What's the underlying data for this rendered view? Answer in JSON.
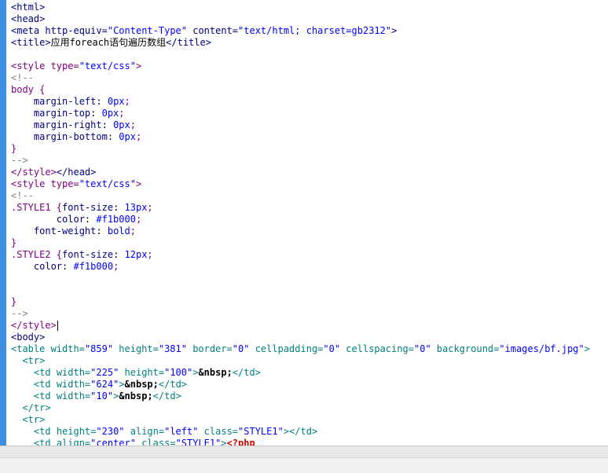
{
  "editor": {
    "lines": [
      [
        {
          "c": "tag",
          "t": "<html>"
        }
      ],
      [
        {
          "c": "tag",
          "t": "<head>"
        }
      ],
      [
        {
          "c": "tag",
          "t": "<meta "
        },
        {
          "c": "tag",
          "t": "http-equiv="
        },
        {
          "c": "val",
          "t": "\"Content-Type\""
        },
        {
          "c": "tag",
          "t": " content="
        },
        {
          "c": "val",
          "t": "\"text/html; charset=gb2312\""
        },
        {
          "c": "tag",
          "t": ">"
        }
      ],
      [
        {
          "c": "tag",
          "t": "<title>"
        },
        {
          "c": "text",
          "t": "应用foreach语句遍历数组"
        },
        {
          "c": "tag",
          "t": "</title>"
        }
      ],
      [],
      [
        {
          "c": "style",
          "t": "<style "
        },
        {
          "c": "style",
          "t": "type="
        },
        {
          "c": "val",
          "t": "\"text/css\""
        },
        {
          "c": "style",
          "t": ">"
        }
      ],
      [
        {
          "c": "comment",
          "t": "<!--"
        }
      ],
      [
        {
          "c": "css",
          "t": "body {"
        }
      ],
      [
        {
          "c": "text",
          "t": "    "
        },
        {
          "c": "prop",
          "t": "margin-left"
        },
        {
          "c": "text",
          "t": ": "
        },
        {
          "c": "propval",
          "t": "0px"
        },
        {
          "c": "css",
          "t": ";"
        }
      ],
      [
        {
          "c": "text",
          "t": "    "
        },
        {
          "c": "prop",
          "t": "margin-top"
        },
        {
          "c": "text",
          "t": ": "
        },
        {
          "c": "propval",
          "t": "0px"
        },
        {
          "c": "css",
          "t": ";"
        }
      ],
      [
        {
          "c": "text",
          "t": "    "
        },
        {
          "c": "prop",
          "t": "margin-right"
        },
        {
          "c": "text",
          "t": ": "
        },
        {
          "c": "propval",
          "t": "0px"
        },
        {
          "c": "css",
          "t": ";"
        }
      ],
      [
        {
          "c": "text",
          "t": "    "
        },
        {
          "c": "prop",
          "t": "margin-bottom"
        },
        {
          "c": "text",
          "t": ": "
        },
        {
          "c": "propval",
          "t": "0px"
        },
        {
          "c": "css",
          "t": ";"
        }
      ],
      [
        {
          "c": "css",
          "t": "}"
        }
      ],
      [
        {
          "c": "comment",
          "t": "-->"
        }
      ],
      [
        {
          "c": "style",
          "t": "</style>"
        },
        {
          "c": "tag",
          "t": "</head>"
        }
      ],
      [
        {
          "c": "style",
          "t": "<style "
        },
        {
          "c": "style",
          "t": "type="
        },
        {
          "c": "val",
          "t": "\"text/css\""
        },
        {
          "c": "style",
          "t": ">"
        }
      ],
      [
        {
          "c": "comment",
          "t": "<!--"
        }
      ],
      [
        {
          "c": "css",
          "t": ".STYLE1 {"
        },
        {
          "c": "prop",
          "t": "font-size"
        },
        {
          "c": "text",
          "t": ": "
        },
        {
          "c": "propval",
          "t": "13px"
        },
        {
          "c": "css",
          "t": ";"
        }
      ],
      [
        {
          "c": "text",
          "t": "        "
        },
        {
          "c": "prop",
          "t": "color"
        },
        {
          "c": "text",
          "t": ": "
        },
        {
          "c": "propval",
          "t": "#f1b000"
        },
        {
          "c": "css",
          "t": ";"
        }
      ],
      [
        {
          "c": "text",
          "t": "    "
        },
        {
          "c": "prop",
          "t": "font-weight"
        },
        {
          "c": "text",
          "t": ": "
        },
        {
          "c": "propval",
          "t": "bold"
        },
        {
          "c": "css",
          "t": ";"
        }
      ],
      [
        {
          "c": "css",
          "t": "}"
        }
      ],
      [
        {
          "c": "css",
          "t": ".STYLE2 {"
        },
        {
          "c": "prop",
          "t": "font-size"
        },
        {
          "c": "text",
          "t": ": "
        },
        {
          "c": "propval",
          "t": "12px"
        },
        {
          "c": "css",
          "t": ";"
        }
      ],
      [
        {
          "c": "text",
          "t": "    "
        },
        {
          "c": "prop",
          "t": "color"
        },
        {
          "c": "text",
          "t": ": "
        },
        {
          "c": "propval",
          "t": "#f1b000"
        },
        {
          "c": "css",
          "t": ";"
        }
      ],
      [],
      [],
      [
        {
          "c": "css",
          "t": "}"
        }
      ],
      [
        {
          "c": "comment",
          "t": "-->"
        }
      ],
      [
        {
          "c": "style",
          "t": "</style>"
        },
        {
          "c": "caret",
          "t": ""
        }
      ],
      [
        {
          "c": "tag",
          "t": "<body>"
        }
      ],
      [
        {
          "c": "attr",
          "t": "<table "
        },
        {
          "c": "attr",
          "t": "width="
        },
        {
          "c": "val",
          "t": "\"859\""
        },
        {
          "c": "attr",
          "t": " height="
        },
        {
          "c": "val",
          "t": "\"381\""
        },
        {
          "c": "attr",
          "t": " border="
        },
        {
          "c": "val",
          "t": "\"0\""
        },
        {
          "c": "attr",
          "t": " cellpadding="
        },
        {
          "c": "val",
          "t": "\"0\""
        },
        {
          "c": "attr",
          "t": " cellspacing="
        },
        {
          "c": "val",
          "t": "\"0\""
        },
        {
          "c": "attr",
          "t": " background="
        },
        {
          "c": "val",
          "t": "\"images/bf.jpg\""
        },
        {
          "c": "attr",
          "t": ">"
        }
      ],
      [
        {
          "c": "text",
          "t": "  "
        },
        {
          "c": "attr",
          "t": "<tr>"
        }
      ],
      [
        {
          "c": "text",
          "t": "    "
        },
        {
          "c": "attr",
          "t": "<td "
        },
        {
          "c": "attr",
          "t": "width="
        },
        {
          "c": "val",
          "t": "\"225\""
        },
        {
          "c": "attr",
          "t": " height="
        },
        {
          "c": "val",
          "t": "\"100\""
        },
        {
          "c": "attr",
          "t": ">"
        },
        {
          "c": "entity",
          "t": "&nbsp;"
        },
        {
          "c": "attr",
          "t": "</td>"
        }
      ],
      [
        {
          "c": "text",
          "t": "    "
        },
        {
          "c": "attr",
          "t": "<td "
        },
        {
          "c": "attr",
          "t": "width="
        },
        {
          "c": "val",
          "t": "\"624\""
        },
        {
          "c": "attr",
          "t": ">"
        },
        {
          "c": "entity",
          "t": "&nbsp;"
        },
        {
          "c": "attr",
          "t": "</td>"
        }
      ],
      [
        {
          "c": "text",
          "t": "    "
        },
        {
          "c": "attr",
          "t": "<td "
        },
        {
          "c": "attr",
          "t": "width="
        },
        {
          "c": "val",
          "t": "\"10\""
        },
        {
          "c": "attr",
          "t": ">"
        },
        {
          "c": "entity",
          "t": "&nbsp;"
        },
        {
          "c": "attr",
          "t": "</td>"
        }
      ],
      [
        {
          "c": "text",
          "t": "  "
        },
        {
          "c": "attr",
          "t": "</tr>"
        }
      ],
      [
        {
          "c": "text",
          "t": "  "
        },
        {
          "c": "attr",
          "t": "<tr>"
        }
      ],
      [
        {
          "c": "text",
          "t": "    "
        },
        {
          "c": "attr",
          "t": "<td "
        },
        {
          "c": "attr",
          "t": "height="
        },
        {
          "c": "val",
          "t": "\"230\""
        },
        {
          "c": "attr",
          "t": " align="
        },
        {
          "c": "val",
          "t": "\"left\""
        },
        {
          "c": "attr",
          "t": " class="
        },
        {
          "c": "val",
          "t": "\"STYLE1\""
        },
        {
          "c": "attr",
          "t": ">"
        },
        {
          "c": "attr",
          "t": "</td>"
        }
      ],
      [
        {
          "c": "text",
          "t": "    "
        },
        {
          "c": "attr",
          "t": "<td "
        },
        {
          "c": "attr",
          "t": "align="
        },
        {
          "c": "val",
          "t": "\"center\""
        },
        {
          "c": "attr",
          "t": " class="
        },
        {
          "c": "val",
          "t": "\"STYLE1\""
        },
        {
          "c": "attr",
          "t": ">"
        },
        {
          "c": "php",
          "t": "<?php"
        }
      ]
    ]
  }
}
